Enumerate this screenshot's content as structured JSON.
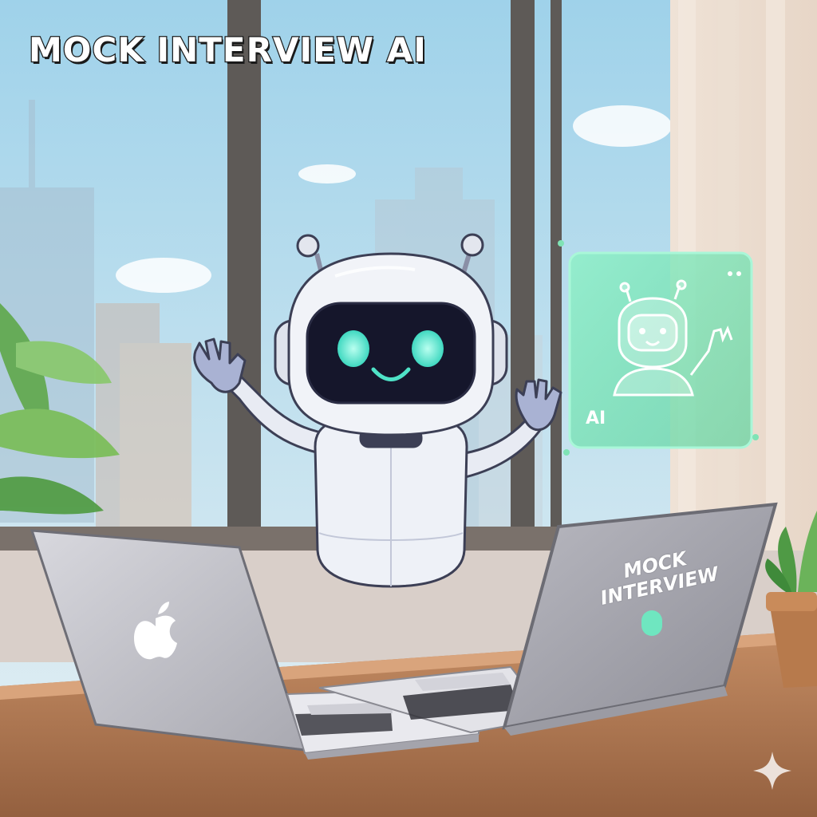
{
  "title": "MOCK INTERVIEW AI",
  "hologram": {
    "label": "AI",
    "icon": "robot-avatar-icon"
  },
  "laptop_right": {
    "line1": "MOCK",
    "line2": "INTERVIEW",
    "icon": "mic-icon"
  },
  "laptop_left": {
    "icon": "apple-logo-icon"
  },
  "watermark": {
    "icon": "sparkle-icon"
  },
  "colors": {
    "accent": "#5de3c4",
    "hologram": "#7fe3b5",
    "robot_body": "#eef1f7",
    "robot_visor": "#15162b",
    "desk": "#b07852",
    "sky": "#cfe6f2"
  }
}
